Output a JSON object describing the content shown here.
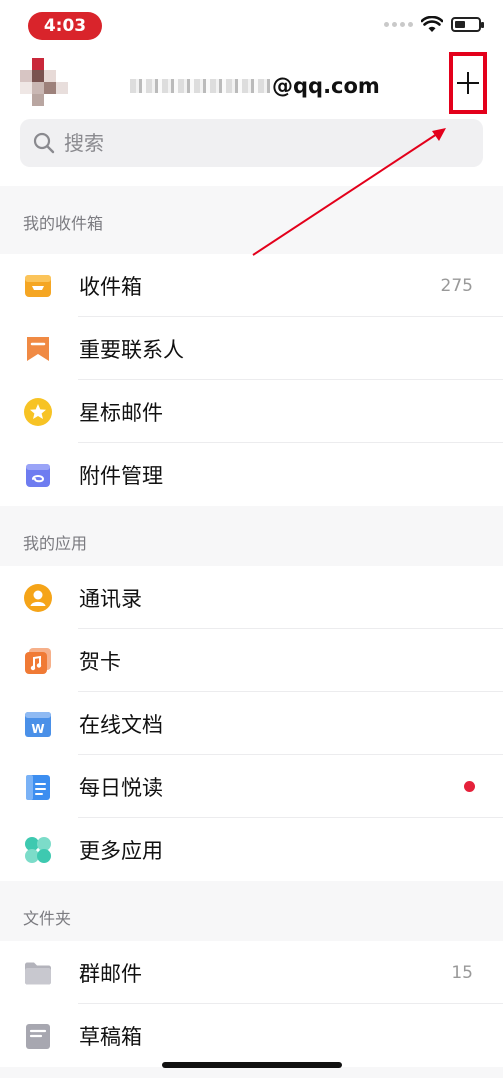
{
  "status_bar": {
    "time": "4:03",
    "battery_level": 0.45
  },
  "account": {
    "email_suffix": "@qq.com"
  },
  "search": {
    "placeholder": "搜索"
  },
  "sections": [
    {
      "title": "我的收件箱",
      "items": [
        {
          "label": "收件箱",
          "count": "275",
          "icon": "inbox-icon",
          "color": "#f5a623"
        },
        {
          "label": "重要联系人",
          "icon": "bookmark-icon",
          "color": "#f08a44"
        },
        {
          "label": "星标邮件",
          "icon": "star-icon",
          "color": "#f7c325"
        },
        {
          "label": "附件管理",
          "icon": "attachment-icon",
          "color": "#6e7cf0"
        }
      ]
    },
    {
      "title": "我的应用",
      "items": [
        {
          "label": "通讯录",
          "icon": "contacts-icon",
          "color": "#f5a418"
        },
        {
          "label": "贺卡",
          "icon": "card-music-icon",
          "color": "#f07a35"
        },
        {
          "label": "在线文档",
          "icon": "document-w-icon",
          "color": "#4a90e8"
        },
        {
          "label": "每日悦读",
          "icon": "reading-icon",
          "color": "#3d8ef0",
          "badge": "unread"
        },
        {
          "label": "更多应用",
          "icon": "more-apps-icon",
          "color": "#3ec9b0"
        }
      ]
    },
    {
      "title": "文件夹",
      "items": [
        {
          "label": "群邮件",
          "count": "15",
          "icon": "folder-icon",
          "color": "#b3b3bb"
        },
        {
          "label": "草稿箱",
          "icon": "drafts-icon",
          "color": "#a7a7b0"
        }
      ]
    }
  ],
  "colors": {
    "highlight": "#e3001b",
    "unread_dot": "#e5213a"
  }
}
